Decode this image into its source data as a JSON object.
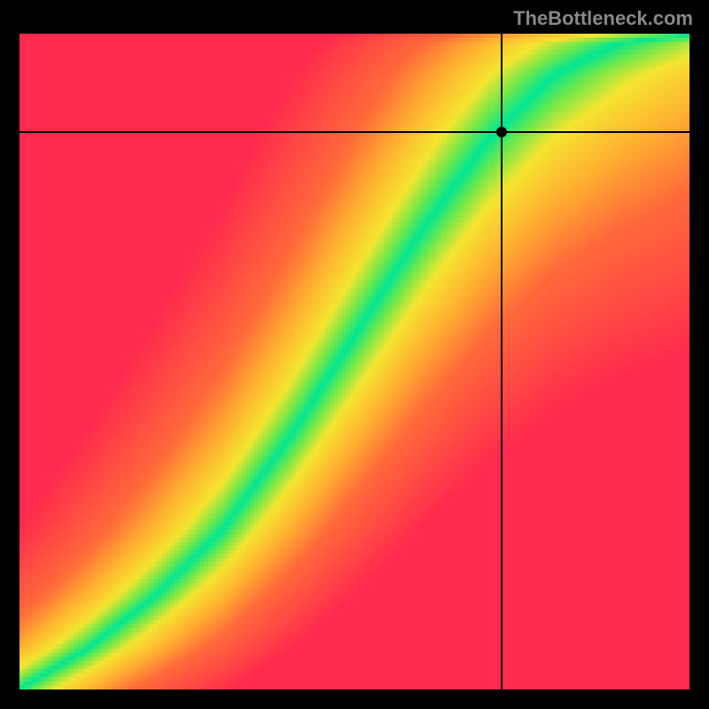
{
  "watermark": "TheBottleneck.com",
  "chart_data": {
    "type": "heatmap",
    "title": "",
    "xlabel": "",
    "ylabel": "",
    "xlim": [
      0,
      100
    ],
    "ylim": [
      0,
      100
    ],
    "crosshair": {
      "x": 72,
      "y": 85
    },
    "marker": {
      "x": 72,
      "y": 85
    },
    "optimal_curve": {
      "description": "S-shaped optimal line from lower-left to upper-right",
      "points": [
        {
          "x": 0,
          "y": 0
        },
        {
          "x": 10,
          "y": 6
        },
        {
          "x": 20,
          "y": 14
        },
        {
          "x": 30,
          "y": 24
        },
        {
          "x": 40,
          "y": 38
        },
        {
          "x": 50,
          "y": 54
        },
        {
          "x": 60,
          "y": 70
        },
        {
          "x": 70,
          "y": 84
        },
        {
          "x": 80,
          "y": 94
        },
        {
          "x": 90,
          "y": 99
        },
        {
          "x": 100,
          "y": 100
        }
      ]
    },
    "color_stops": [
      {
        "distance": 0.0,
        "color": "#00e694"
      },
      {
        "distance": 0.08,
        "color": "#6fe84a"
      },
      {
        "distance": 0.18,
        "color": "#f5e530"
      },
      {
        "distance": 0.35,
        "color": "#ffb030"
      },
      {
        "distance": 0.55,
        "color": "#ff6a3a"
      },
      {
        "distance": 1.0,
        "color": "#ff2a4d"
      }
    ],
    "resolution": 160
  }
}
